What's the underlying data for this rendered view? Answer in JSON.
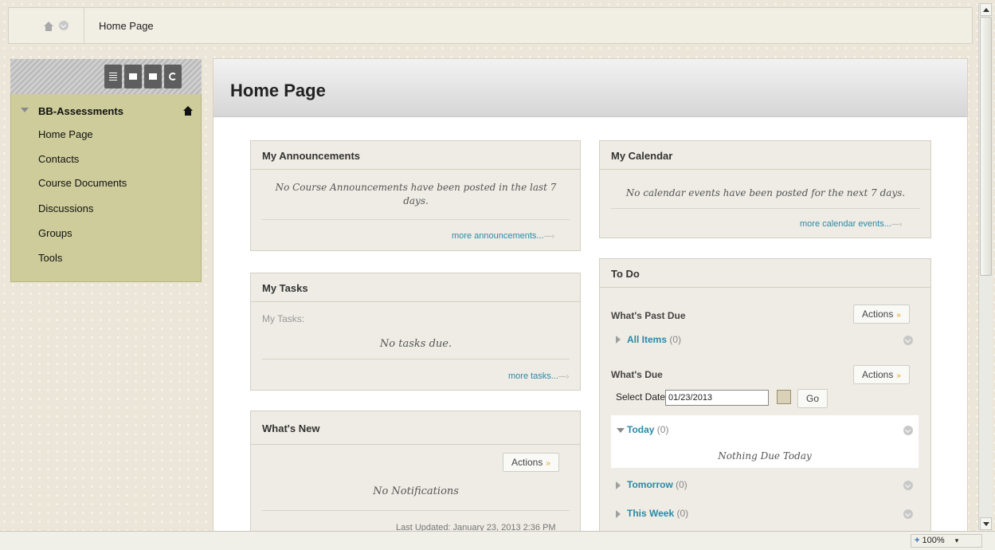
{
  "breadcrumb": {
    "current": "Home Page"
  },
  "course_menu": {
    "title": "BB-Assessments",
    "items": [
      "Home Page",
      "Contacts",
      "Course Documents",
      "Discussions",
      "Groups",
      "Tools"
    ]
  },
  "page": {
    "title": "Home Page"
  },
  "announcements": {
    "title": "My Announcements",
    "message": "No Course Announcements have been posted in the last 7 days.",
    "more_link": "more announcements..."
  },
  "tasks": {
    "title": "My Tasks",
    "label": "My Tasks:",
    "message": "No tasks due.",
    "more_link": "more tasks..."
  },
  "whats_new": {
    "title": "What's New",
    "actions_label": "Actions",
    "message": "No Notifications",
    "last_updated": "Last Updated: January 23, 2013 2:36 PM"
  },
  "calendar": {
    "title": "My Calendar",
    "message": "No calendar events have been posted for the next 7 days.",
    "more_link": "more calendar events..."
  },
  "todo": {
    "title": "To Do",
    "past_due": {
      "label": "What's Past Due",
      "actions_label": "Actions",
      "all_items": "All Items",
      "all_items_count": "(0)"
    },
    "due": {
      "label": "What's Due",
      "actions_label": "Actions",
      "select_date_label": "Select Date:",
      "date_value": "01/23/2013",
      "go_label": "Go",
      "today": "Today",
      "today_count": "(0)",
      "today_message": "Nothing Due Today",
      "tomorrow": "Tomorrow",
      "tomorrow_count": "(0)",
      "this_week": "This Week",
      "this_week_count": "(0)"
    }
  },
  "statusbar": {
    "zoom": "100%"
  }
}
